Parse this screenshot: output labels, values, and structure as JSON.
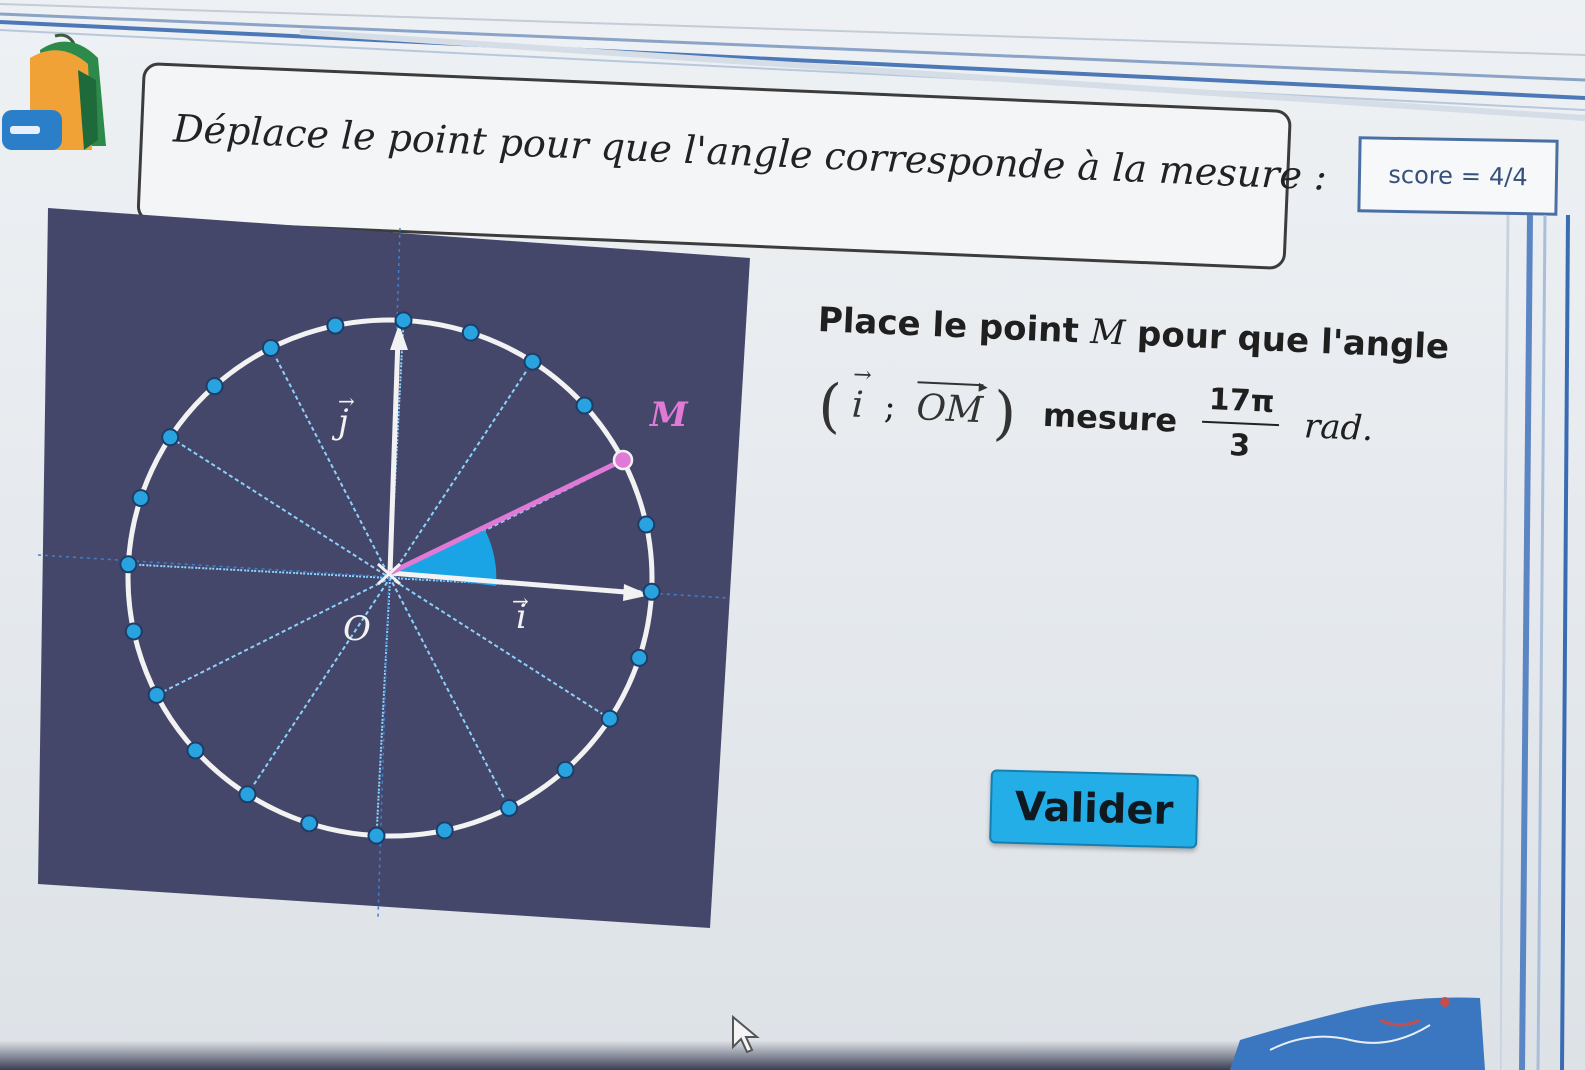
{
  "instruction": {
    "text": "Déplace le point pour que l'angle corresponde à la mesure :"
  },
  "score": {
    "label": "score",
    "equals": "=",
    "value": "4/4"
  },
  "figure": {
    "label_j": "j",
    "label_i": "i",
    "label_O": "O",
    "label_M": "M",
    "colors": {
      "background": "#45476a",
      "circle": "#f2f2f2",
      "point_fill": "#29a3e0",
      "segment_OM": "#e07ad6",
      "angle_fill": "#1aa4e6"
    },
    "subdivisions": 12
  },
  "question": {
    "line1_start": "Place le point",
    "line1_var": "M",
    "line1_end": "pour que l'angle",
    "vector_i": "i",
    "separator": ";",
    "vector_OM": "OM",
    "mesure": "mesure",
    "fraction_num": "17π",
    "fraction_den": "3",
    "unit": "rad."
  },
  "button": {
    "label": "Valider"
  }
}
